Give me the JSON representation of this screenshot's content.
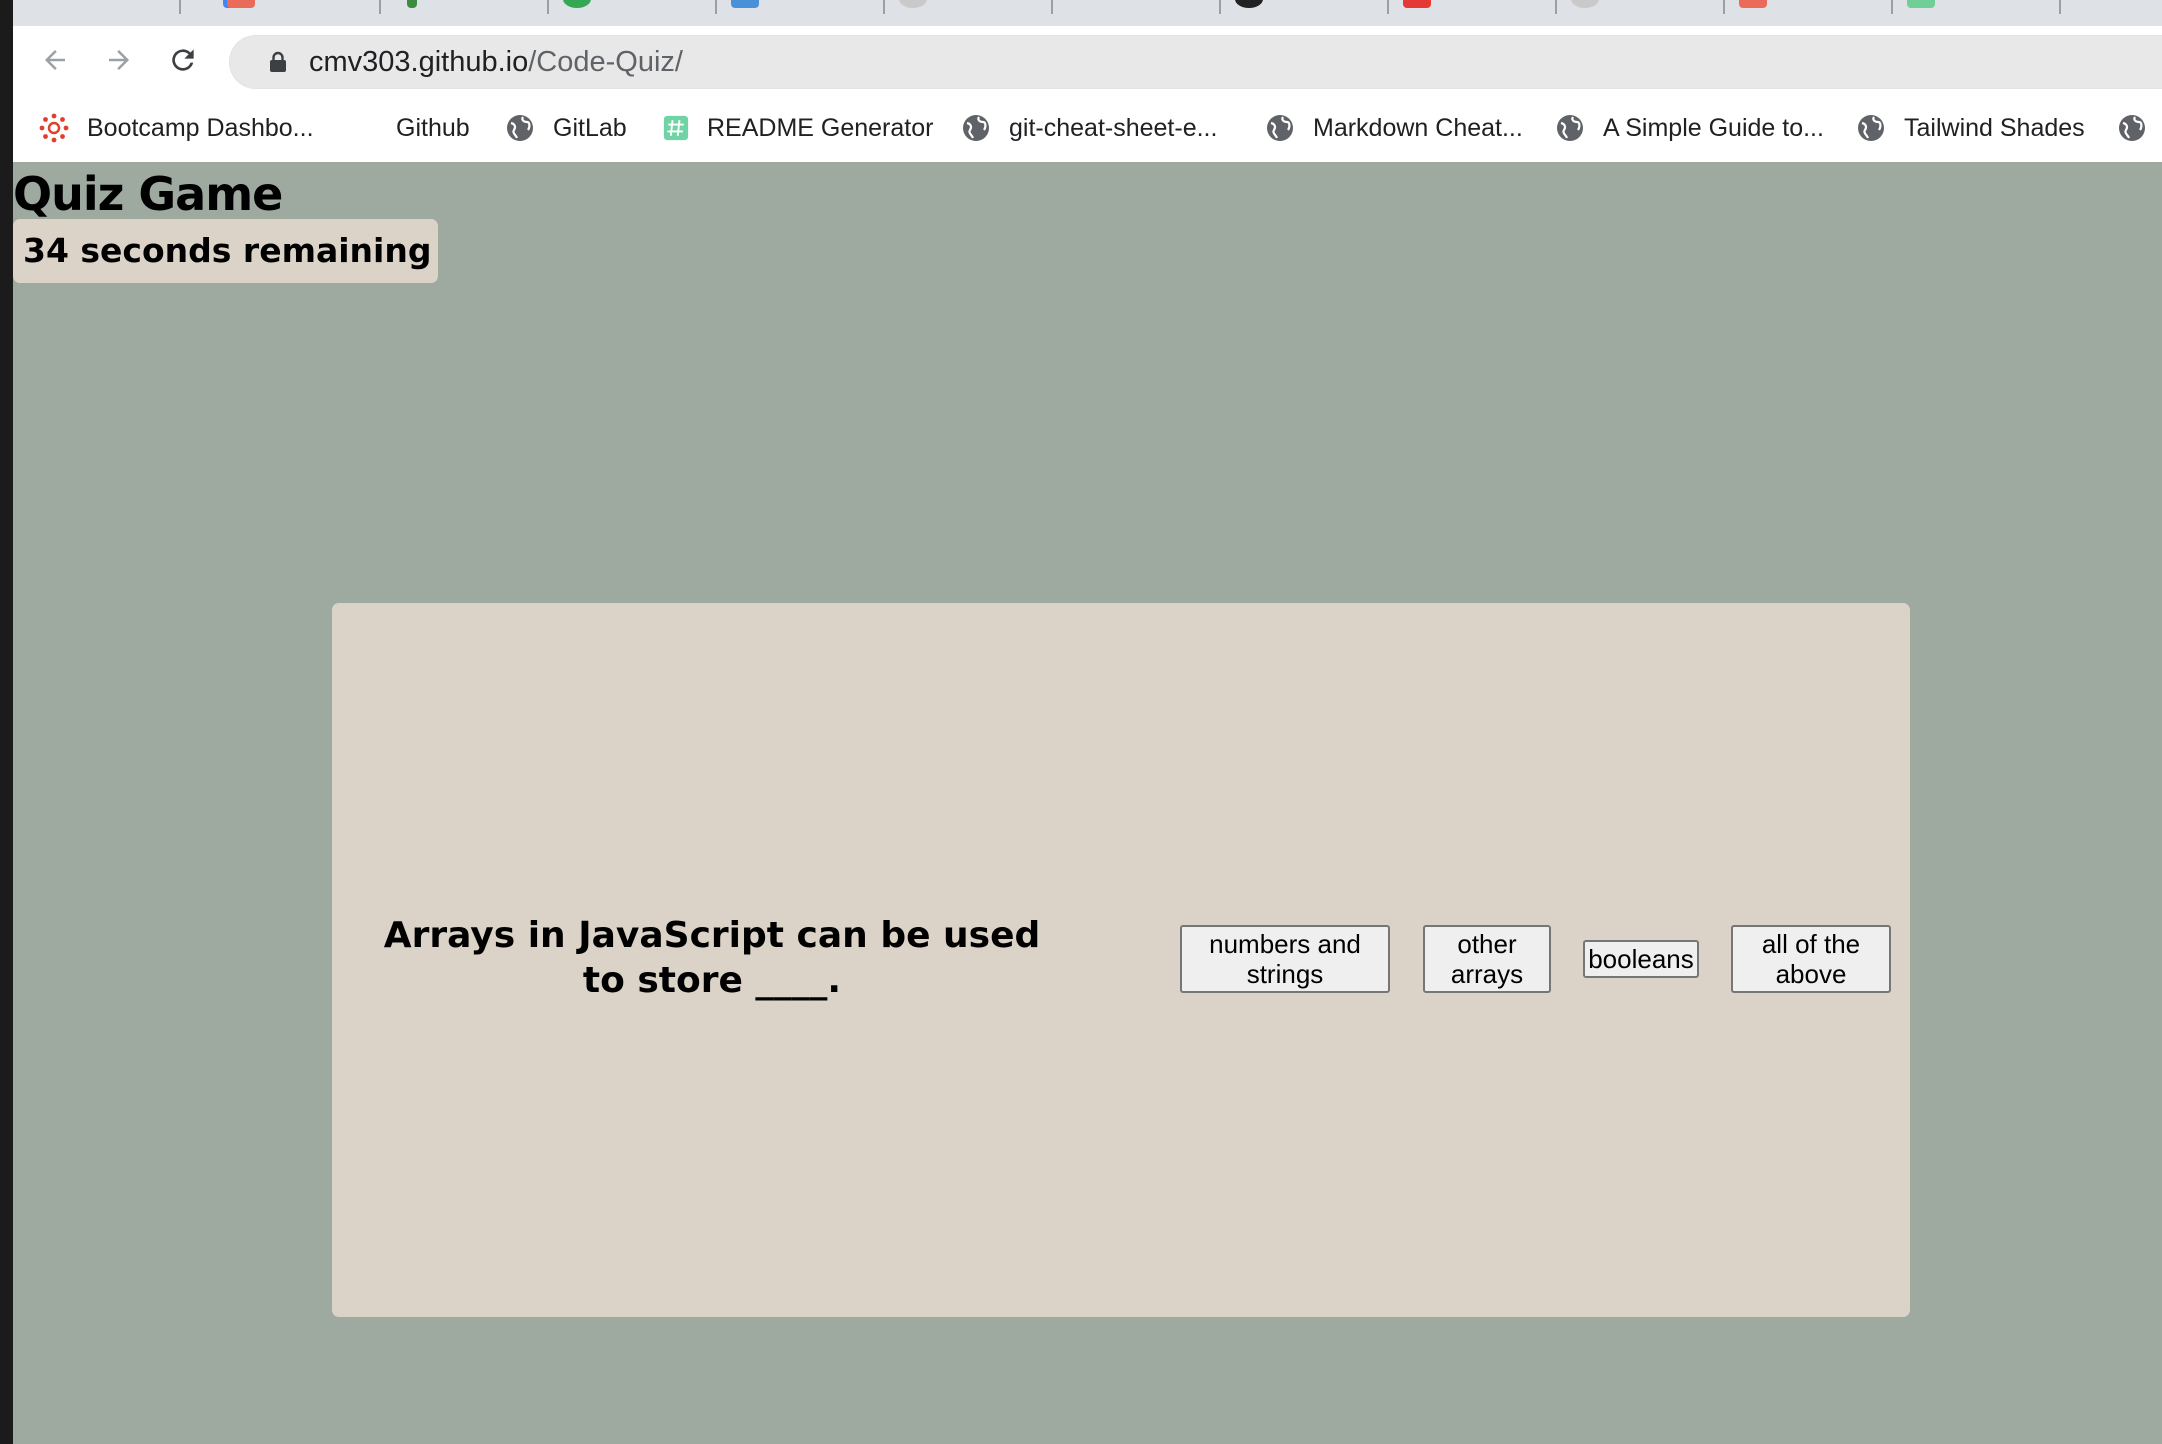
{
  "browser": {
    "url_host": "cmv303.github.io",
    "url_path": "/Code-Quiz/",
    "bookmarks": [
      {
        "label": "Bootcamp Dashbo...",
        "icon": "canvas-icon"
      },
      {
        "label": "Github",
        "icon": "none"
      },
      {
        "label": "GitLab",
        "icon": "globe-icon"
      },
      {
        "label": "README Generator",
        "icon": "hash-icon"
      },
      {
        "label": "git-cheat-sheet-e...",
        "icon": "globe-icon"
      },
      {
        "label": "Markdown Cheat...",
        "icon": "globe-icon"
      },
      {
        "label": "A Simple Guide to...",
        "icon": "globe-icon"
      },
      {
        "label": "Tailwind Shades",
        "icon": "globe-icon"
      }
    ]
  },
  "page": {
    "title": "Quiz Game",
    "timer_text": "34 seconds remaining"
  },
  "quiz": {
    "question": "Arrays in JavaScript can be used to store ____.",
    "answers": [
      "numbers and strings",
      "other arrays",
      "booleans",
      "all of the above"
    ]
  },
  "colors": {
    "page_bg": "#9ea9a0",
    "card_bg": "#dbd3c8"
  }
}
